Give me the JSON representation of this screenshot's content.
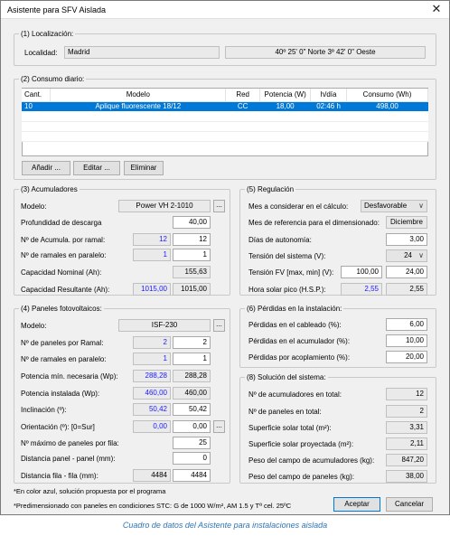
{
  "window": {
    "title": "Asistente para SFV Aislada",
    "close": "✕"
  },
  "localizacion": {
    "legend": "(1) Localización:",
    "label": "Localidad:",
    "value": "Madrid",
    "coords": "40º 25' 0\" Norte 3º 42' 0\" Oeste"
  },
  "consumo": {
    "legend": "(2) Consumo diario:",
    "headers": [
      "Cant.",
      "Modelo",
      "Red",
      "Potencia (W)",
      "h/día",
      "Consumo (Wh)"
    ],
    "rows": [
      [
        "10",
        "Aplique fluorescente 18/12",
        "CC",
        "18,00",
        "02:46 h",
        "498,00"
      ]
    ],
    "buttons": {
      "add": "Añadir ...",
      "edit": "Editar ...",
      "delete": "Eliminar"
    }
  },
  "acumuladores": {
    "legend": "(3) Acumuladores",
    "modelo_label": "Modelo:",
    "modelo_value": "Power VH 2-1010",
    "profundidad_label": "Profundidad de descarga",
    "profundidad_value": "40,00",
    "acumula_label": "Nº de Acumula. por ramal:",
    "acumula_prop": "12",
    "acumula_value": "12",
    "ramales_label": "Nº de ramales en paralelo:",
    "ramales_prop": "1",
    "ramales_value": "1",
    "nominal_label": "Capacidad Nominal (Ah):",
    "nominal_value": "155,63",
    "resultante_label": "Capacidad Resultante (Ah):",
    "resultante_prop": "1015,00",
    "resultante_value": "1015,00"
  },
  "paneles": {
    "legend": "(4) Paneles fotovoltaicos:",
    "modelo_label": "Modelo:",
    "modelo_value": "ISF-230",
    "por_ramal_label": "Nº de paneles por Ramal:",
    "por_ramal_prop": "2",
    "por_ramal_value": "2",
    "ramales_label": "Nº de ramales en paralelo:",
    "ramales_prop": "1",
    "ramales_value": "1",
    "pot_min_label": "Potencia mín. necesaria (Wp):",
    "pot_min_prop": "288,28",
    "pot_min_value": "288,28",
    "pot_inst_label": "Potencia instalada (Wp):",
    "pot_inst_prop": "460,00",
    "pot_inst_value": "460,00",
    "inclinacion_label": "Inclinación (º):",
    "inclinacion_prop": "50,42",
    "inclinacion_value": "50,42",
    "orientacion_label": "Orientación (º): [0=Sur]",
    "orientacion_prop": "0,00",
    "orientacion_value": "0,00",
    "max_fila_label": "Nº máximo de paneles por fila:",
    "max_fila_value": "25",
    "dist_panel_label": "Distancia panel - panel (mm):",
    "dist_panel_value": "0",
    "dist_fila_label": "Distancia fila - fila (mm):",
    "dist_fila_prop": "4484",
    "dist_fila_value": "4484"
  },
  "regulacion": {
    "legend": "(5) Regulación",
    "mes_label": "Mes a considerar en el cálculo:",
    "mes_value": "Desfavorable",
    "mes_ref_label": "Mes de referencia para el dimensionado:",
    "mes_ref_value": "Diciembre",
    "dias_label": "Días de autonomía:",
    "dias_value": "3,00",
    "tension_label": "Tensión del sistema (V):",
    "tension_value": "24",
    "tension_fv_label": "Tensión FV [max, min] (V):",
    "tension_fv_max": "100,00",
    "tension_fv_min": "24,00",
    "hsp_label": "Hora solar pico (H.S.P.):",
    "hsp_prop": "2,55",
    "hsp_value": "2,55"
  },
  "perdidas": {
    "legend": "(6) Pérdidas en la instalación:",
    "cableado_label": "Pérdidas en el cableado (%):",
    "cableado_value": "6,00",
    "acumulador_label": "Pérdidas en el acumulador (%):",
    "acumulador_value": "10,00",
    "acoplamiento_label": "Pérdidas por acoplamiento (%):",
    "acoplamiento_value": "20,00"
  },
  "solucion": {
    "legend": "(8) Solución del sistema:",
    "acum_total_label": "Nº de acumuladores en total:",
    "acum_total_value": "12",
    "paneles_total_label": "Nº de paneles en total:",
    "paneles_total_value": "2",
    "superficie_label": "Superficie solar total (m²):",
    "superficie_value": "3,31",
    "superficie_proy_label": "Superficie solar proyectada (m²):",
    "superficie_proy_value": "2,11",
    "peso_acum_label": "Peso del campo de acumuladores (kg):",
    "peso_acum_value": "847,20",
    "peso_paneles_label": "Peso del campo de paneles (kg):",
    "peso_paneles_value": "38,00"
  },
  "notes": {
    "azul": "*En color azul, solución propuesta por el programa",
    "stc": "*Predimensionado con paneles en condiciones STC: G de 1000 W/m², AM 1.5 y Tª cel. 25ºC"
  },
  "footer": {
    "accept": "Aceptar",
    "cancel": "Cancelar",
    "ellipsis": "...",
    "chevron": "∨"
  },
  "caption": "Cuadro de datos del Asistente para instalaciones aislada"
}
